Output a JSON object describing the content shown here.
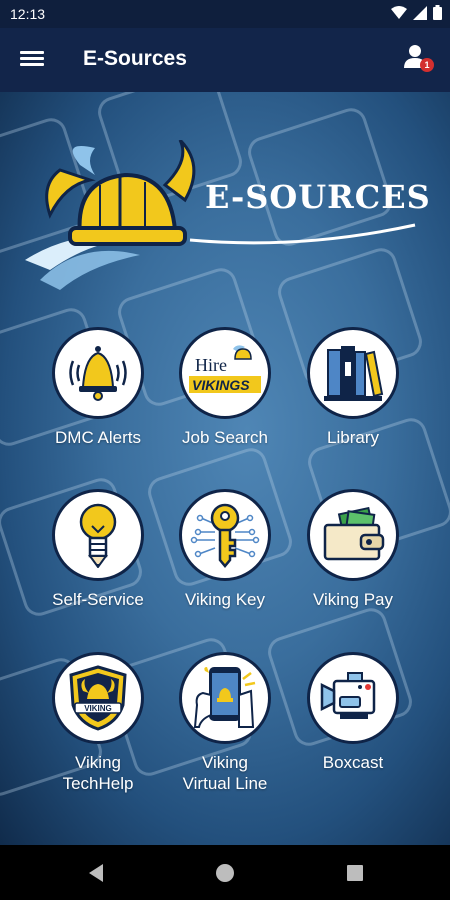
{
  "status_bar": {
    "time": "12:13"
  },
  "app_bar": {
    "title": "E-Sources",
    "notification_count": "1"
  },
  "logo": {
    "text": "E-SOURCES"
  },
  "tiles": [
    {
      "label": "DMC Alerts",
      "icon": "bell-icon"
    },
    {
      "label": "Job Search",
      "icon": "hire-vikings-icon",
      "icon_text_1": "Hire",
      "icon_text_2": "VIKINGS"
    },
    {
      "label": "Library",
      "icon": "books-icon"
    },
    {
      "label": "Self-Service",
      "icon": "lightbulb-pencil-icon"
    },
    {
      "label": "Viking Key",
      "icon": "key-icon"
    },
    {
      "label": "Viking Pay",
      "icon": "wallet-icon"
    },
    {
      "label": "Viking\nTechHelp",
      "label_line1": "Viking",
      "label_line2": "TechHelp",
      "icon": "techhelp-shield-icon",
      "icon_text": "VIKING"
    },
    {
      "label": "Viking\nVirtual Line",
      "label_line1": "Viking",
      "label_line2": "Virtual Line",
      "icon": "phone-hand-icon"
    },
    {
      "label": "Boxcast",
      "icon": "video-camera-icon"
    }
  ],
  "colors": {
    "app_bar": "#12254a",
    "status_bar": "#0f1f3d",
    "navy": "#0f2448",
    "gold": "#f2c81c",
    "light_blue": "#8fc3ea"
  }
}
